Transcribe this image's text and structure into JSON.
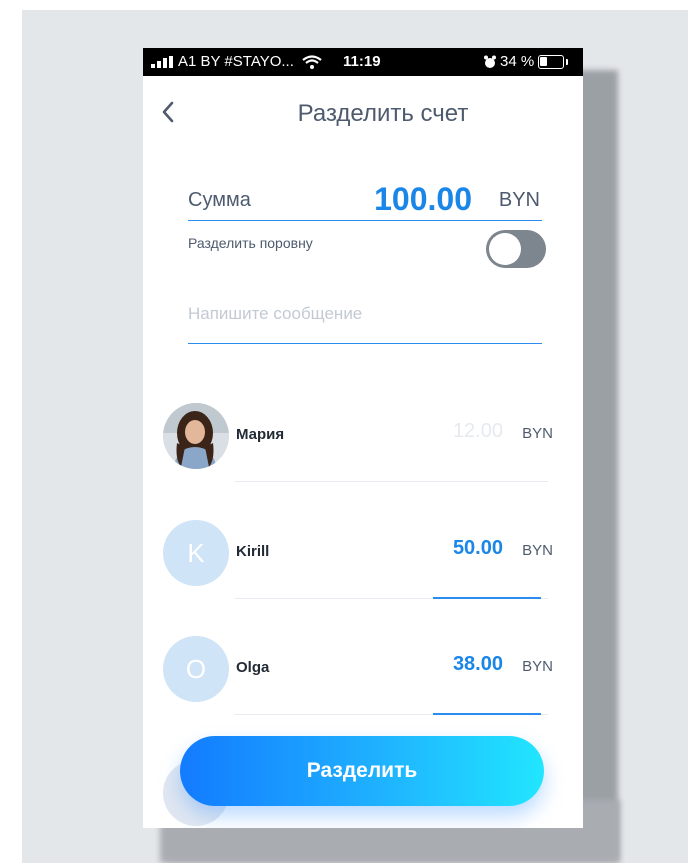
{
  "status_bar": {
    "carrier": "A1 BY #STAYO...",
    "time": "11:19",
    "battery_text": "34 %",
    "battery_level": 0.34
  },
  "header": {
    "back_label": "‹",
    "title": "Разделить счет"
  },
  "amount": {
    "label": "Сумма",
    "value": "100.00",
    "currency": "BYN"
  },
  "split_equally": {
    "label": "Разделить поровну",
    "enabled": false
  },
  "message": {
    "placeholder": "Напишите сообщение",
    "value": ""
  },
  "participants": [
    {
      "name": "Мария",
      "amount": "12.00",
      "amount_is_placeholder": true,
      "currency": "BYN",
      "avatar": "photo"
    },
    {
      "name": "Kirill",
      "initial": "K",
      "amount": "50.00",
      "amount_is_placeholder": false,
      "currency": "BYN",
      "avatar": "initial"
    },
    {
      "name": "Olga",
      "initial": "O",
      "amount": "38.00",
      "amount_is_placeholder": false,
      "currency": "BYN",
      "avatar": "initial"
    }
  ],
  "primary_button": {
    "label": "Разделить"
  },
  "colors": {
    "accent": "#1a86e8",
    "gradient_start": "#137bff",
    "gradient_end": "#21e6ff",
    "text": "#4e5b6e"
  }
}
